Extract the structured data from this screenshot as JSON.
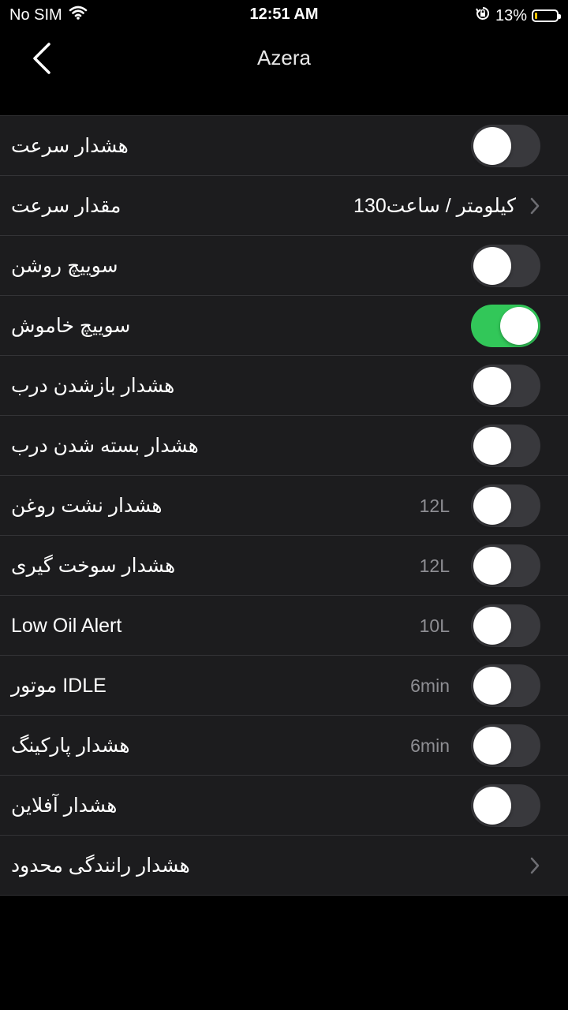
{
  "status_bar": {
    "carrier": "No SIM",
    "time": "12:51 AM",
    "battery": "13%",
    "battery_level": 0.13,
    "battery_color": "#f5c400"
  },
  "nav": {
    "title": "Azera",
    "back_icon": "chevron-left-icon"
  },
  "colors": {
    "toggle_on": "#32c759",
    "toggle_off": "#39393d",
    "row_bg": "#1c1c1e"
  },
  "rows": [
    {
      "label": "هشدار سرعت",
      "control": "toggle",
      "on": false
    },
    {
      "label": "مقدار سرعت",
      "control": "chevron",
      "value": "130کیلومتر / ساعت"
    },
    {
      "label": "سوییچ روشن",
      "control": "toggle",
      "on": false
    },
    {
      "label": "سوییچ خاموش",
      "control": "toggle",
      "on": true
    },
    {
      "label": "هشدار بازشدن درب",
      "control": "toggle",
      "on": false
    },
    {
      "label": "هشدار بسته شدن درب",
      "control": "toggle",
      "on": false
    },
    {
      "label": "هشدار نشت روغن",
      "control": "toggle",
      "on": false,
      "value": "12L"
    },
    {
      "label": "هشدار سوخت گیری",
      "control": "toggle",
      "on": false,
      "value": "12L"
    },
    {
      "label": "Low Oil Alert",
      "control": "toggle",
      "on": false,
      "value": "10L"
    },
    {
      "label": "موتور IDLE",
      "control": "toggle",
      "on": false,
      "value": "6min"
    },
    {
      "label": "هشدار پارکینگ",
      "control": "toggle",
      "on": false,
      "value": "6min"
    },
    {
      "label": "هشدار آفلاین",
      "control": "toggle",
      "on": false
    },
    {
      "label": "هشدار رانندگی محدود",
      "control": "chevron"
    }
  ]
}
